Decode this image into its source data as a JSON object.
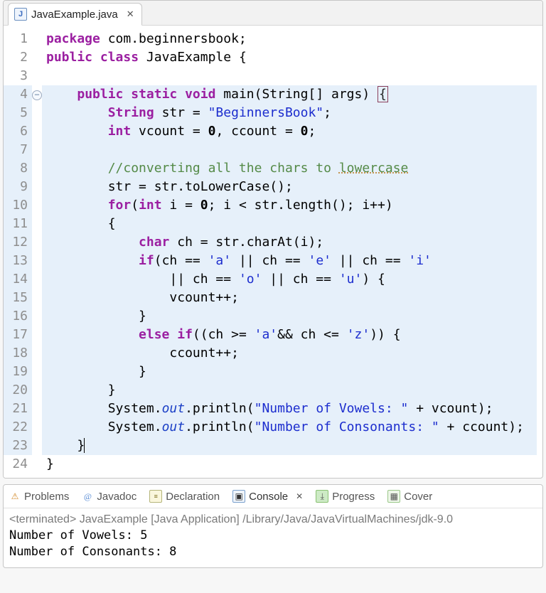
{
  "editor": {
    "tab": {
      "icon_letter": "J",
      "filename": "JavaExample.java",
      "close_glyph": "✕"
    },
    "line_numbers": [
      "1",
      "2",
      "3",
      "4",
      "5",
      "6",
      "7",
      "8",
      "9",
      "10",
      "11",
      "12",
      "13",
      "14",
      "15",
      "16",
      "17",
      "18",
      "19",
      "20",
      "21",
      "22",
      "23",
      "24"
    ],
    "highlighted_lines": [
      4,
      5,
      6,
      7,
      8,
      9,
      10,
      11,
      12,
      13,
      14,
      15,
      16,
      17,
      18,
      19,
      20,
      21,
      22,
      23
    ],
    "fold_marker_line": 4,
    "fold_marker_glyph": "−",
    "code": {
      "l1_kw_package": "package",
      "l1_pkg": " com.beginnersbook;",
      "l2_kw_pub": "public",
      "l2_kw_class": " class",
      "l2_name": " JavaExample {",
      "l4_kw_pub": "public",
      "l4_kw_static": " static",
      "l4_kw_void": " void",
      "l4_main": " main(String[] args) ",
      "l4_brace": "{",
      "l5_type": "String",
      "l5_rest": " str = ",
      "l5_str": "\"BeginnersBook\"",
      "l5_end": ";",
      "l6_kw_int": "int",
      "l6_a": " vcount = ",
      "l6_zero1": "0",
      "l6_b": ", ccount = ",
      "l6_zero2": "0",
      "l6_end": ";",
      "l8_comment_a": "//converting all the chars to ",
      "l8_comment_b": "lowercase",
      "l9": "str = str.toLowerCase();",
      "l10_kw_for": "for",
      "l10_a": "(",
      "l10_kw_int": "int",
      "l10_b": " i = ",
      "l10_zero": "0",
      "l10_c": "; i < str.length(); i++)",
      "l11": "{",
      "l12_kw_char": "char",
      "l12_rest": " ch = str.charAt(i);",
      "l13_kw_if": "if",
      "l13_a": "(ch == ",
      "l13_s1": "'a'",
      "l13_b": " || ch == ",
      "l13_s2": "'e'",
      "l13_c": " || ch == ",
      "l13_s3": "'i'",
      "l14_a": "|| ch == ",
      "l14_s1": "'o'",
      "l14_b": " || ch == ",
      "l14_s2": "'u'",
      "l14_c": ") {",
      "l15": "vcount++;",
      "l16": "}",
      "l17_kw_else": "else",
      "l17_kw_if": " if",
      "l17_a": "((ch >= ",
      "l17_s1": "'a'",
      "l17_b": "&& ch <= ",
      "l17_s2": "'z'",
      "l17_c": ")) {",
      "l18": "ccount++;",
      "l19": "}",
      "l20": "}",
      "l21_a": "System.",
      "l21_out": "out",
      "l21_b": ".println(",
      "l21_str": "\"Number of Vowels: \"",
      "l21_c": " + vcount);",
      "l22_a": "System.",
      "l22_out": "out",
      "l22_b": ".println(",
      "l22_str": "\"Number of Consonants: \"",
      "l22_c": " + ccount);",
      "l23": "}",
      "l24": "}"
    }
  },
  "views": {
    "problems": "Problems",
    "javadoc": "Javadoc",
    "declaration": "Declaration",
    "console": "Console",
    "progress": "Progress",
    "coverage": "Cover",
    "close_glyph": "✕"
  },
  "console": {
    "header": "<terminated> JavaExample [Java Application] /Library/Java/JavaVirtualMachines/jdk-9.0",
    "line1": "Number of Vowels: 5",
    "line2": "Number of Consonants: 8"
  }
}
